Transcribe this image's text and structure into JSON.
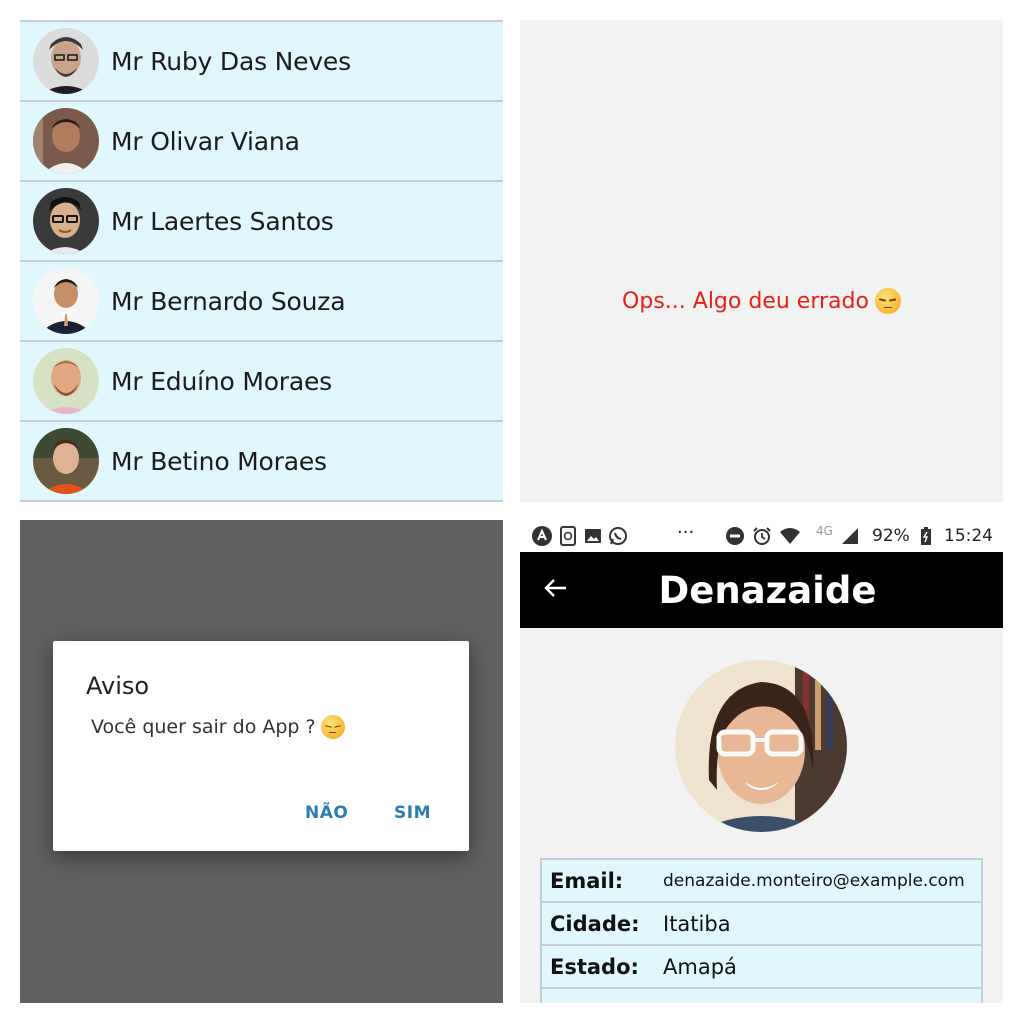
{
  "list": {
    "users": [
      {
        "name": "Mr Ruby Das Neves"
      },
      {
        "name": "Mr Olivar Viana"
      },
      {
        "name": "Mr Laertes Santos"
      },
      {
        "name": "Mr Bernardo Souza"
      },
      {
        "name": "Mr Eduíno Moraes"
      },
      {
        "name": "Mr Betino Moraes"
      }
    ]
  },
  "error": {
    "message": "Ops... Algo deu errado",
    "color": "#e52219",
    "emoji": "pensive-face"
  },
  "dialog": {
    "title": "Aviso",
    "body": "Você quer sair do App ?",
    "no_label": "NÃO",
    "yes_label": "SIM",
    "button_color": "#2d7db3"
  },
  "statusbar": {
    "network": "4G",
    "battery": "92%",
    "time": "15:24",
    "more": "···"
  },
  "detail": {
    "title": "Denazaide",
    "fields": [
      {
        "label": "Email:",
        "value": "denazaide.monteiro@example.com"
      },
      {
        "label": "Cidade:",
        "value": "Itatiba"
      },
      {
        "label": "Estado:",
        "value": "Amapá"
      }
    ]
  },
  "colors": {
    "row_bg": "#e0f7fd",
    "divider": "#c5ccd6",
    "appbar": "#000000",
    "dialog_overlay": "#616161"
  }
}
